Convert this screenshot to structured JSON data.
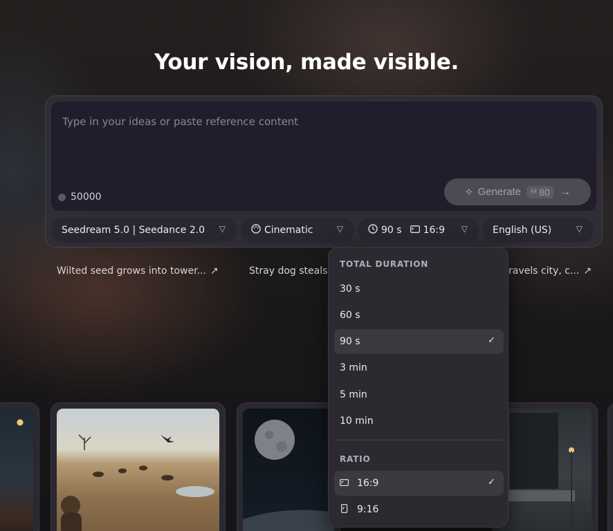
{
  "hero": {
    "title": "Your vision, made visible."
  },
  "composer": {
    "placeholder": "Type in your ideas or paste reference content",
    "credits": "50000",
    "generate_label": "Generate",
    "generate_cost": "80"
  },
  "toolbar": {
    "model": "Seedream 5.0 | Seedance 2.0",
    "style": "Cinematic",
    "duration": "90 s",
    "ratio": "16:9",
    "language": "English (US)"
  },
  "suggestions": [
    {
      "label": "Wilted seed grows into tower..."
    },
    {
      "label": "Stray dog steals"
    },
    {
      "label": "ravels city, c..."
    }
  ],
  "dropdown": {
    "duration_header": "TOTAL DURATION",
    "duration_options": [
      "30 s",
      "60 s",
      "90 s",
      "3 min",
      "5 min",
      "10 min"
    ],
    "duration_selected": "90 s",
    "ratio_header": "RATIO",
    "ratio_options": [
      "16:9",
      "9:16"
    ],
    "ratio_selected": "16:9"
  },
  "icons": {
    "generate": "sparkle-icon",
    "style": "palette-icon",
    "duration": "clock-icon",
    "ratio": "aspect-ratio-icon",
    "dropdown": "chevron-down-icon",
    "selected": "check-icon",
    "open_suggestion": "arrow-up-right-icon"
  }
}
